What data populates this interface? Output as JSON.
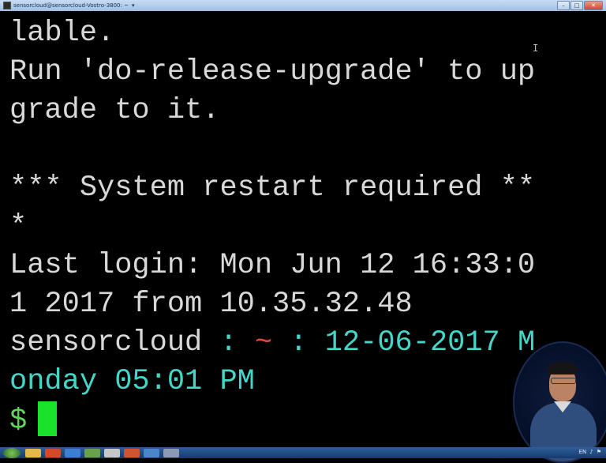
{
  "window": {
    "title": "sensorcloud@sensorcloud-Vostro-3800: ~",
    "minimize_label": "–",
    "maximize_label": "□",
    "close_label": "✕"
  },
  "terminal": {
    "lines": [
      "lable.",
      "Run 'do-release-upgrade' to up",
      "grade to it.",
      "",
      "*** System restart required **",
      "*",
      "Last login: Mon Jun 12 16:33:0",
      "1 2017 from 10.35.32.48"
    ],
    "prompt": {
      "user": "sensorcloud",
      "sep1": " : ",
      "path": "~",
      "sep2": " : ",
      "date_part": "12-06-2017 M",
      "date_cont": "onday 05:01 PM",
      "symbol": "$"
    }
  },
  "taskbar": {
    "icons": [
      "start-orb",
      "explorer-icon",
      "media-icon",
      "ie-icon",
      "paint-icon",
      "chrome-icon",
      "powerpoint-icon",
      "network-icon",
      "putty-icon"
    ],
    "tray_text": "EN"
  },
  "colors": {
    "background": "#000000",
    "text": "#d8d8d8",
    "prompt_cyan": "#44d6c8",
    "path_red": "#e0473f",
    "cursor_green": "#19e22a"
  }
}
